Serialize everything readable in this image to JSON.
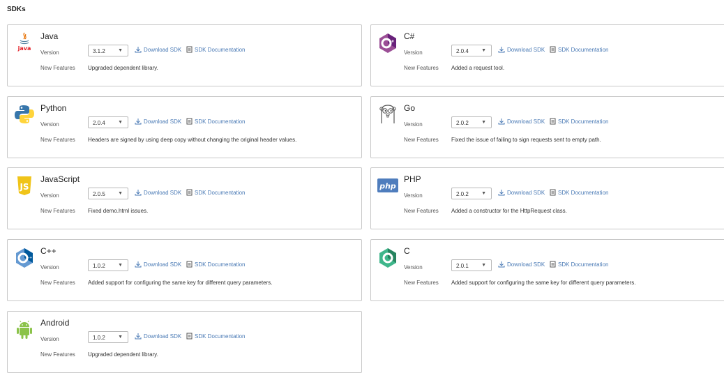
{
  "page": {
    "title": "SDKs"
  },
  "labels": {
    "version": "Version",
    "new_features": "New Features",
    "download": "Download SDK",
    "docs": "SDK Documentation"
  },
  "sdks": [
    {
      "name": "Java",
      "version": "3.1.2",
      "features": "Upgraded dependent library.",
      "logo_text": "java"
    },
    {
      "name": "C#",
      "version": "2.0.4",
      "features": "Added a request tool."
    },
    {
      "name": "Python",
      "version": "2.0.4",
      "features": "Headers are signed by using deep copy without changing the original header values."
    },
    {
      "name": "Go",
      "version": "2.0.2",
      "features": "Fixed the issue of failing to sign requests sent to empty path."
    },
    {
      "name": "JavaScript",
      "version": "2.0.5",
      "features": "Fixed demo.html issues.",
      "logo_text": "JS"
    },
    {
      "name": "PHP",
      "version": "2.0.2",
      "features": "Added a constructor for the HttpRequest class.",
      "logo_text": "php"
    },
    {
      "name": "C++",
      "version": "1.0.2",
      "features": "Added support for configuring the same key for different query parameters."
    },
    {
      "name": "C",
      "version": "2.0.1",
      "features": "Added support for configuring the same key for different query parameters."
    },
    {
      "name": "Android",
      "version": "1.0.2",
      "features": "Upgraded dependent library."
    }
  ]
}
